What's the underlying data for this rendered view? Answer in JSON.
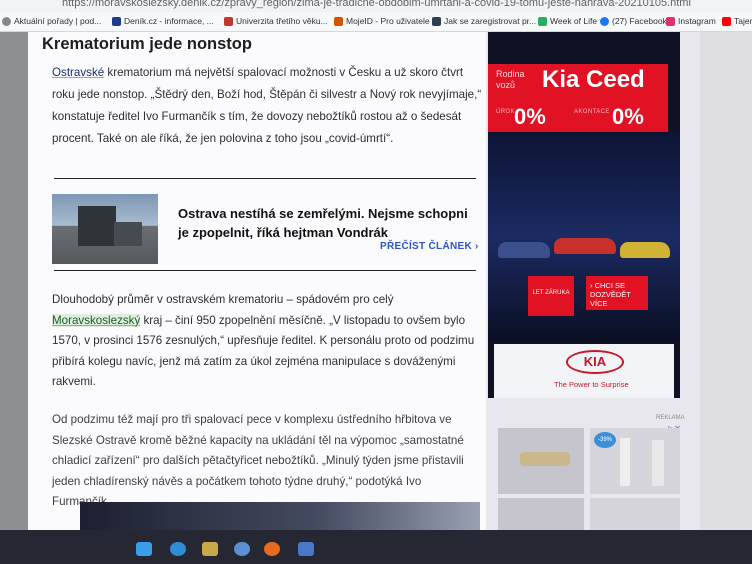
{
  "browser": {
    "url": "https://moravskoslezsky.denik.cz/zpravy_region/zima-je-tradicne-obdobim-umrtani-a-covid-19-tomu-jeste-nahrava-20210105.html",
    "bookmarks": [
      {
        "label": "Aktuální pořady | pod...",
        "icon": "globe-icon",
        "color": "#888888"
      },
      {
        "label": "Deník.cz - informace, ...",
        "icon": "denik-icon",
        "color": "#1f3b8c"
      },
      {
        "label": "Univerzita třetího věku...",
        "icon": "university-icon",
        "color": "#c0392b"
      },
      {
        "label": "MojeID - Pro uživatele",
        "icon": "mojeid-icon",
        "color": "#d35400"
      },
      {
        "label": "Jak se zaregistrovat pr...",
        "icon": "page-icon",
        "color": "#2c3e50"
      },
      {
        "label": "Week of Life",
        "icon": "weekoflife-icon",
        "color": "#27ae60"
      },
      {
        "label": "(27) Facebook",
        "icon": "facebook-icon",
        "color": "#1877f2"
      },
      {
        "label": "Instagram",
        "icon": "instagram-icon",
        "color": "#e1306c"
      },
      {
        "label": "Tajem",
        "icon": "youtube-icon",
        "color": "#ff0000"
      }
    ]
  },
  "article": {
    "heading": "Krematorium jede nonstop",
    "para1": {
      "link": "Ostravské",
      "text": " krematorium má největší spalovací možnosti v Česku a už skoro čtvrt roku jede nonstop. „Štědrý den, Boží hod, Štěpán či silvestr a Nový rok nevyjímaje,“ konstatuje ředitel Ivo Furmančík s tím, že dovozy nebožtíků rostou až o šedesát procent. Také on ale říká, že jen polovina z toho jsou „covid-úmrtí“."
    },
    "related": {
      "title": "Ostrava nestíhá se zemřelými. Nejsme schopni je zpopelnit, říká hejtman Vondrák",
      "read_more": "PŘEČÍST ČLÁNEK ›"
    },
    "para2": {
      "before": "Dlouhodobý průměr v ostravském krematoriu – spádovém pro celý ",
      "link": "Moravskoslezský",
      "after": " kraj – činí 950 zpopelnění měsíčně. „V listopadu to ovšem bylo 1570, v prosinci 1576 zesnulých,“ upřesňuje ředitel. K personálu proto od podzimu přibírá kolegu navíc, jenž má zatím za úkol zejména manipulace s dováženými rakvemi."
    },
    "para3": "Od podzimu též mají pro tři spalovací pece v komplexu ústředního hřbitova ve Slezské Ostravě kromě běžné kapacity na ukládání těl na výpomoc „samostatné chladicí zařízení“ pro dalších pětačtyřicet nebožtíků. „Minulý týden jsme přistavili jeden chladírenský návěs a počátkem tohoto týdne druhý,“ podotýká Ivo Furmančík."
  },
  "ad": {
    "small": "Rodina\nvozů",
    "brand": "Kia Ceed",
    "rate1_label": "ÚROK",
    "rate1": "0%",
    "rate2_label": "AKONTACE",
    "rate2": "0%",
    "badge": "LET ZÁRUKA",
    "cta": "› CHCI SE DOZVĚDĚT VÍCE",
    "logo": "KIA",
    "slogan": "The Power to Surprise",
    "accent": "#e01224"
  },
  "ad2": {
    "label": "REKLAMA",
    "discount": "-39%"
  }
}
